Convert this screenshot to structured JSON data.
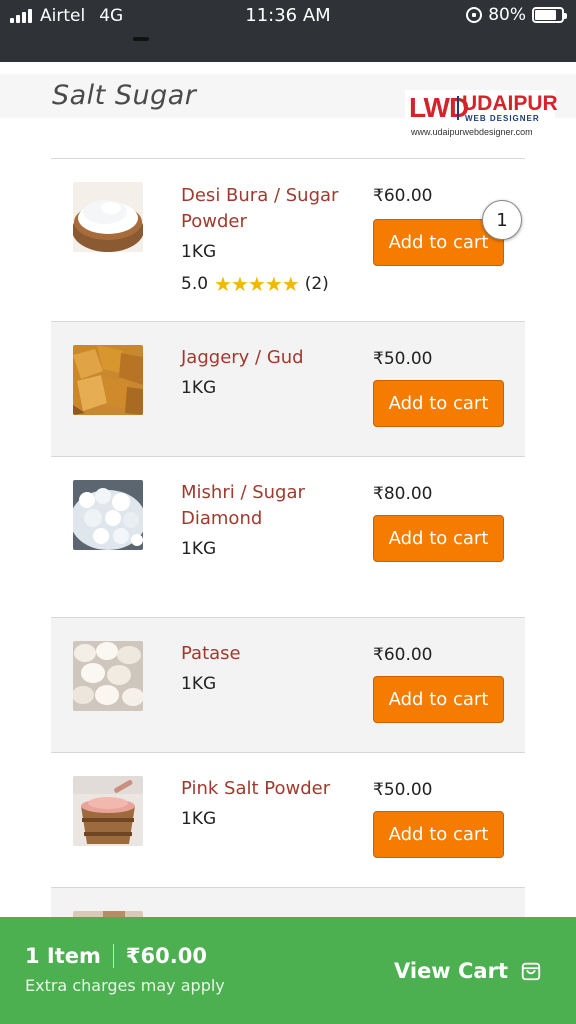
{
  "status_bar": {
    "carrier": "Airtel",
    "network": "4G",
    "time": "11:36 AM",
    "battery": "80%",
    "battery_level": 0.8
  },
  "header": {
    "title": "Salt Sugar",
    "logo": {
      "lwd": "LWD",
      "udaipur": "UDAIPUR",
      "subtitle": "WEB DESIGNER",
      "url": "www.udaipurwebdesigner.com"
    }
  },
  "products": [
    {
      "name": "Desi Bura / Sugar Powder",
      "weight": "1KG",
      "rating": "5.0",
      "stars": "★★★★★",
      "reviews": "(2)",
      "price": "₹60.00",
      "button": "Add to cart",
      "cart_qty": "1"
    },
    {
      "name": "Jaggery / Gud",
      "weight": "1KG",
      "price": "₹50.00",
      "button": "Add to cart"
    },
    {
      "name": "Mishri / Sugar Diamond",
      "weight": "1KG",
      "price": "₹80.00",
      "button": "Add to cart"
    },
    {
      "name": "Patase",
      "weight": "1KG",
      "price": "₹60.00",
      "button": "Add to cart"
    },
    {
      "name": "Pink Salt Powder",
      "weight": "1KG",
      "price": "₹50.00",
      "button": "Add to cart"
    }
  ],
  "cart_bar": {
    "items": "1 Item",
    "total": "₹60.00",
    "note": "Extra charges may apply",
    "view_cart": "View Cart",
    "icon": "shopping-bag-icon"
  },
  "colors": {
    "accent": "#f57c00",
    "product_name": "#a13a2e",
    "cart_bar": "#4caf50",
    "status_bar": "#2f3337"
  }
}
